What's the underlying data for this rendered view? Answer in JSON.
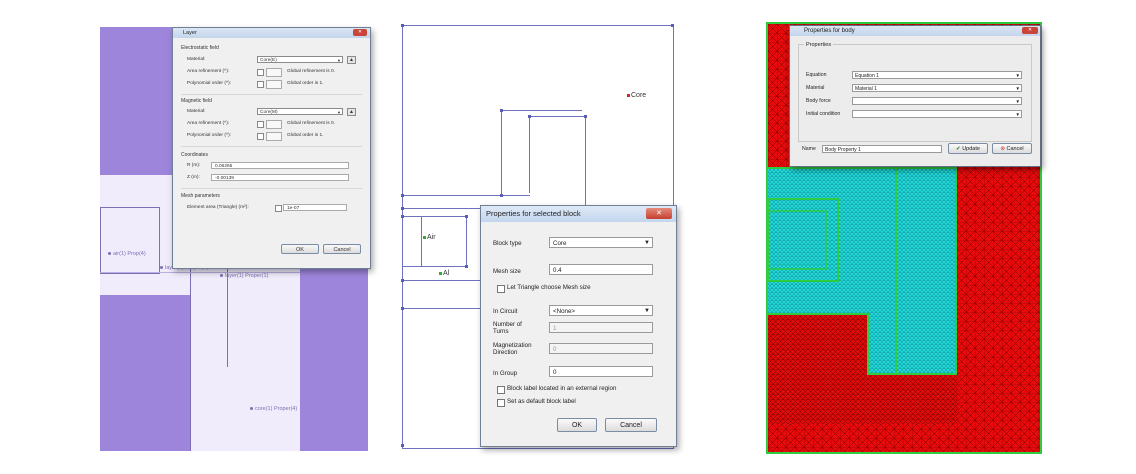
{
  "colors": {
    "panel1_fill": "#9d85dc",
    "panel1_inner": "#f0ecfb",
    "segment_line": "#6f72c0",
    "mesh_red": "#e80b0b",
    "mesh_cyan": "#21dadb",
    "boundary_green": "#2ecc40"
  },
  "panel1": {
    "block_labels": [
      "air(1) Prop(4)",
      "layer(1) Proper(4)",
      "layer(1) Proper(1)",
      "core(1) Proper(4)"
    ],
    "dialog": {
      "title": "Layer",
      "close_label": "✕",
      "electrostatic_title": "Electrostatic field",
      "material_label": "Material:",
      "material_value": "Core(E)",
      "area_refinement_label": "Area refinement (^):",
      "area_refinement_note": "Global refinement is 0.",
      "polynomial_order_label": "Polynomial order (^):",
      "polynomial_order_note": "Global order is 1.",
      "magnetic_title": "Magnetic field",
      "magnetic_material_value": "Core(M)",
      "coordinates_title": "Coordinates",
      "r_label": "R (m):",
      "r_value": "0.06265",
      "z_label": "Z (m):",
      "z_value": "-0.00139",
      "mesh_title": "Mesh parameters",
      "element_area_label": "Element area (Triangle) (m²):",
      "element_area_value": "1e-07",
      "ok_label": "OK",
      "cancel_label": "Cancel"
    }
  },
  "panel2": {
    "markers": {
      "core": "Core",
      "air": "Air",
      "al": "Al"
    },
    "dialog": {
      "title": "Properties for selected block",
      "close_label": "✕",
      "block_type_label": "Block type",
      "block_type_value": "Core",
      "mesh_size_label": "Mesh size",
      "mesh_size_value": "0.4",
      "let_triangle_label": "Let Triangle choose Mesh size",
      "in_circuit_label": "In Circuit",
      "in_circuit_value": "<None>",
      "turns_label_1": "Number of",
      "turns_label_2": "Turns",
      "turns_value": "1",
      "mag_label_1": "Magnetization",
      "mag_label_2": "Direction",
      "mag_value": "0",
      "in_group_label": "In Group",
      "in_group_value": "0",
      "external_region_label": "Block label located in an external region",
      "default_label": "Set as default block label",
      "ok_label": "OK",
      "cancel_label": "Cancel"
    }
  },
  "panel3": {
    "dialog": {
      "title": "Properties for body",
      "close_label": "✕",
      "group_title": "Properties",
      "equation_label": "Equation",
      "equation_value": "Equation 1",
      "material_label": "Material",
      "material_value": "Material 1",
      "body_force_label": "Body force",
      "body_force_value": "",
      "initial_condition_label": "Initial condition",
      "initial_condition_value": "",
      "name_label": "Name",
      "name_value": "Body Property 1",
      "update_label": "Update",
      "cancel_label": "Cancel"
    }
  }
}
